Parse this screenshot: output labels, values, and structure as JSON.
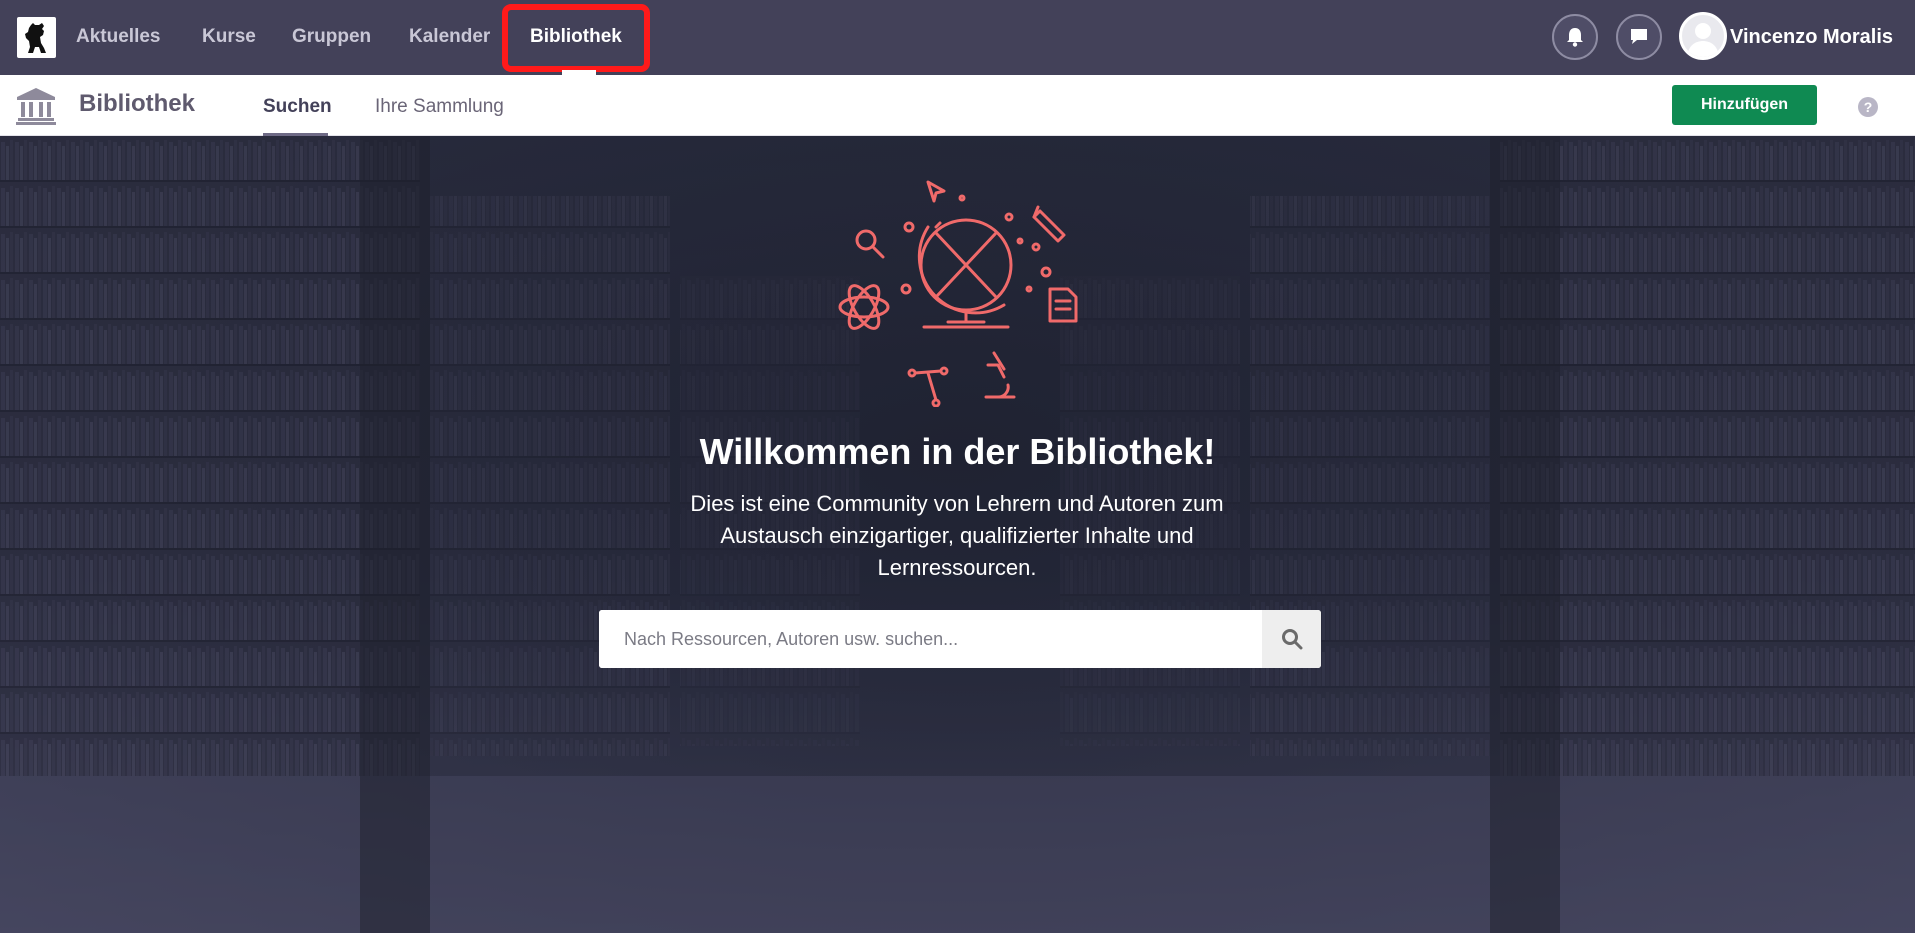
{
  "topnav": {
    "items": [
      {
        "label": "Aktuelles"
      },
      {
        "label": "Kurse"
      },
      {
        "label": "Gruppen"
      },
      {
        "label": "Kalender"
      },
      {
        "label": "Bibliothek",
        "active": true
      }
    ],
    "user_name": "Vincenzo Moralis",
    "icons": [
      "bear-logo-icon",
      "bell-icon",
      "chat-bubble-icon",
      "user-avatar"
    ]
  },
  "subbar": {
    "title": "Bibliothek",
    "tabs": [
      {
        "label": "Suchen",
        "active": true
      },
      {
        "label": "Ihre Sammlung"
      }
    ],
    "add_label": "Hinzufügen",
    "help_label": "?"
  },
  "hero": {
    "title": "Willkommen in der Bibliothek!",
    "description": "Dies ist eine Community von Lehrern und Autoren zum Austausch einzigartiger, qualifizierter Inhalte und Lernressourcen.",
    "search_placeholder": "Nach Ressourcen, Autoren usw. suchen..."
  },
  "colors": {
    "topnav_bg": "#434159",
    "accent_green": "#0f8a52",
    "illustration": "#f06a6a",
    "highlight": "#ff1a1a"
  }
}
